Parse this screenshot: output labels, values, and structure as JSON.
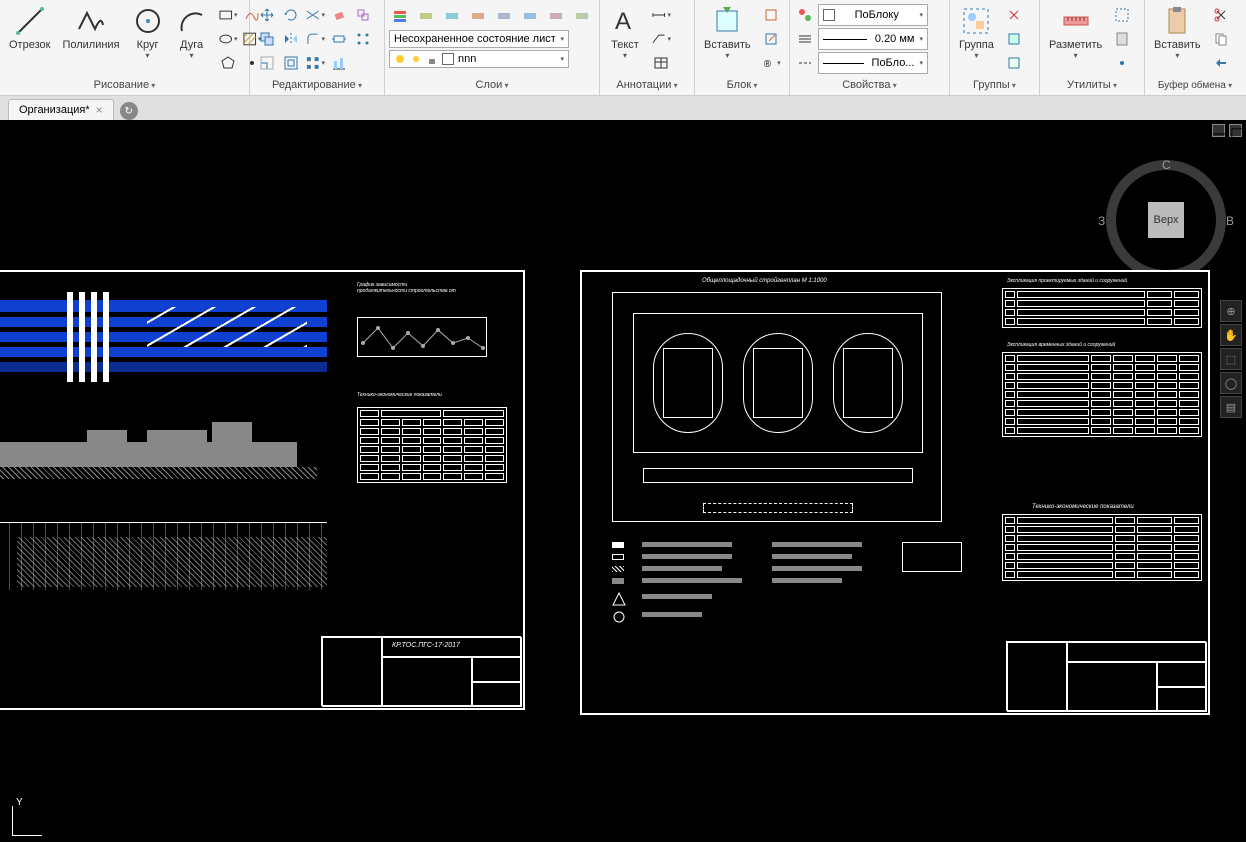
{
  "ribbon": {
    "draw": {
      "title": "Рисование",
      "segment": "Отрезок",
      "polyline": "Полилиния",
      "circle": "Круг",
      "arc": "Дуга"
    },
    "edit": {
      "title": "Редактирование"
    },
    "layers": {
      "title": "Слои",
      "state": "Несохраненное состояние листа",
      "current": "nnn"
    },
    "annotations": {
      "title": "Аннотации",
      "text": "Текст"
    },
    "block": {
      "title": "Блок",
      "insert": "Вставить"
    },
    "properties": {
      "title": "Свойства",
      "color": "ПоБлоку",
      "lineweight": "0.20 мм",
      "linetype": "ПоБло..."
    },
    "groups": {
      "title": "Группы",
      "group": "Группа"
    },
    "utilities": {
      "title": "Утилиты",
      "measure": "Разметить"
    },
    "clipboard": {
      "title": "Буфер обмена",
      "paste": "Вставить"
    }
  },
  "tab": {
    "name": "Организация*"
  },
  "viewcube": {
    "top": "Верх",
    "n": "С",
    "w": "З",
    "e": "В"
  },
  "drawing": {
    "sheet1": {
      "chart_title": "График зависимости продолжительности строительства от",
      "tek_title": "Технико-экономические показатели",
      "project": "КР.ТОС.ПГС-17-2017"
    },
    "sheet2": {
      "plan_title": "Общеплощадочный стройгенплан М 1:1000",
      "expl1_title": "Экспликация проектируемых зданий и сооружений",
      "expl2_title": "Экспликация временных зданий и сооружений",
      "tek_title": "Технико-экономические показатели"
    }
  }
}
